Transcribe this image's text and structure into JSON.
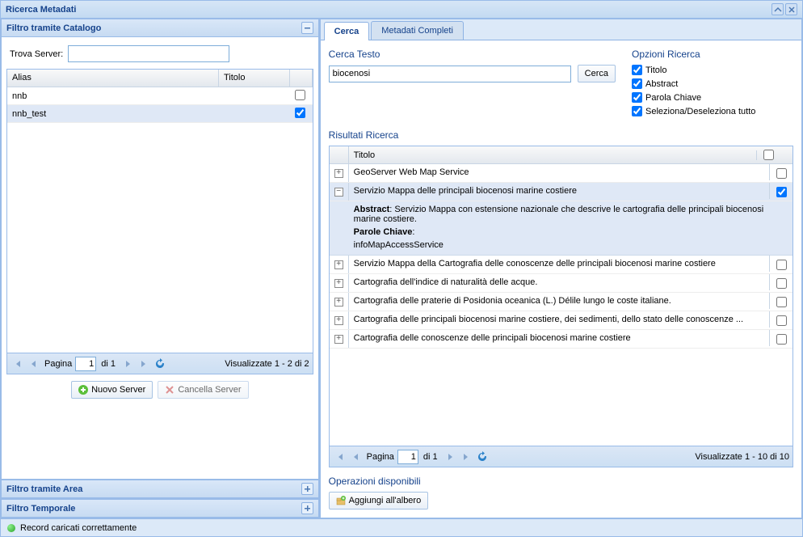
{
  "window": {
    "title": "Ricerca Metadati"
  },
  "left": {
    "accordion": {
      "catalog": {
        "title": "Filtro tramite Catalogo"
      },
      "area": {
        "title": "Filtro tramite Area"
      },
      "temporal": {
        "title": "Filtro Temporale"
      }
    },
    "findServerLabel": "Trova Server:",
    "grid": {
      "headers": {
        "alias": "Alias",
        "title": "Titolo"
      },
      "rows": [
        {
          "alias": "nnb",
          "checked": false
        },
        {
          "alias": "nnb_test",
          "checked": true
        }
      ]
    },
    "paging": {
      "pageLabel": "Pagina",
      "ofLabel": "di 1",
      "page": "1",
      "display": "Visualizzate 1 - 2 di 2"
    },
    "buttons": {
      "newServer": "Nuovo Server",
      "deleteServer": "Cancella Server"
    }
  },
  "right": {
    "tabs": {
      "search": "Cerca",
      "full": "Metadati Completi"
    },
    "searchText": {
      "title": "Cerca Testo",
      "value": "biocenosi",
      "button": "Cerca"
    },
    "options": {
      "title": "Opzioni Ricerca",
      "title_chk": "Titolo",
      "abstract_chk": "Abstract",
      "keyword_chk": "Parola Chiave",
      "selectall_chk": "Seleziona/Deseleziona tutto"
    },
    "results": {
      "title": "Risultati Ricerca",
      "header_title": "Titolo",
      "rows": [
        {
          "title": "GeoServer Web Map Service",
          "checked": false,
          "expanded": false
        },
        {
          "title": "Servizio Mappa delle principali biocenosi marine costiere",
          "checked": true,
          "expanded": true,
          "abstract_label": "Abstract",
          "abstract": ": Servizio Mappa con estensione nazionale che descrive le cartografia delle principali biocenosi marine costiere.",
          "keywords_label": "Parole Chiave",
          "keywords": "infoMapAccessService"
        },
        {
          "title": "Servizio Mappa della Cartografia delle conoscenze delle principali biocenosi marine costiere",
          "checked": false,
          "expanded": false
        },
        {
          "title": "Cartografia dell'indice di naturalità delle acque.",
          "checked": false,
          "expanded": false
        },
        {
          "title": "Cartografia delle praterie di Posidonia oceanica (L.) Délile lungo le coste italiane.",
          "checked": false,
          "expanded": false
        },
        {
          "title": "Cartografia delle principali biocenosi marine costiere, dei sedimenti, dello stato delle conoscenze ...",
          "checked": false,
          "expanded": false
        },
        {
          "title": "Cartografia delle conoscenze delle principali biocenosi marine costiere",
          "checked": false,
          "expanded": false
        }
      ],
      "paging": {
        "pageLabel": "Pagina",
        "ofLabel": "di 1",
        "page": "1",
        "display": "Visualizzate 1 - 10 di 10"
      }
    },
    "ops": {
      "title": "Operazioni disponibili",
      "addTree": "Aggiungi all'albero"
    }
  },
  "status": "Record caricati correttamente"
}
